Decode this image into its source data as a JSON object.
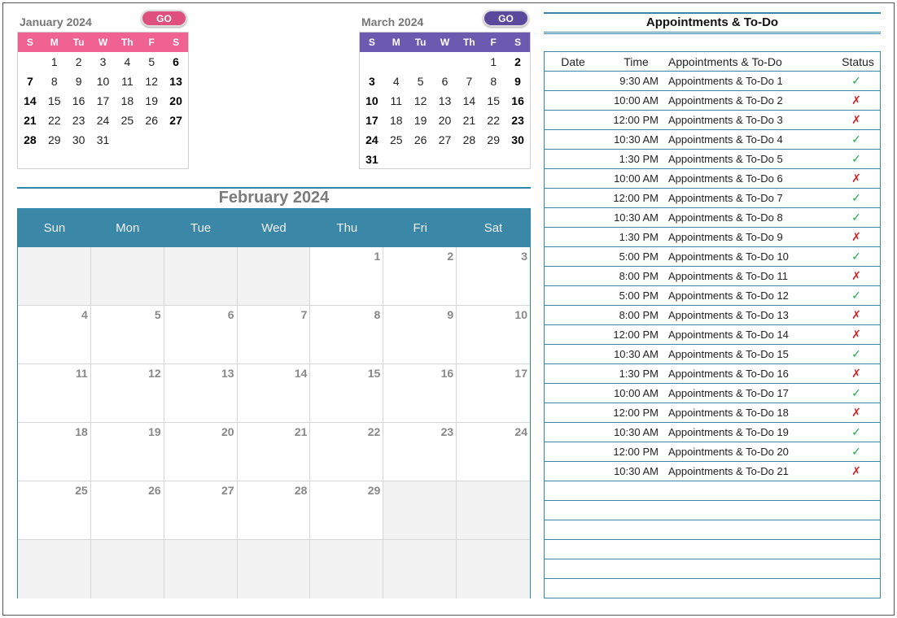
{
  "colors": {
    "accent": "#3a87a8",
    "january_header": "#f06292",
    "march_header": "#6a5bb0",
    "go_january": "#e0507f",
    "go_march": "#5a4a9e",
    "done": "#1fa84a",
    "not_done": "#d0232a"
  },
  "jan": {
    "title": "January 2024",
    "go": "GO",
    "dow": [
      "S",
      "M",
      "Tu",
      "W",
      "Th",
      "F",
      "S"
    ],
    "days": [
      "",
      "1",
      "2",
      "3",
      "4",
      "5",
      "6",
      "7",
      "8",
      "9",
      "10",
      "11",
      "12",
      "13",
      "14",
      "15",
      "16",
      "17",
      "18",
      "19",
      "20",
      "21",
      "22",
      "23",
      "24",
      "25",
      "26",
      "27",
      "28",
      "29",
      "30",
      "31"
    ]
  },
  "mar": {
    "title": "March 2024",
    "go": "GO",
    "dow": [
      "S",
      "M",
      "Tu",
      "W",
      "Th",
      "F",
      "S"
    ],
    "days": [
      "",
      "",
      "",
      "",
      "",
      "1",
      "2",
      "3",
      "4",
      "5",
      "6",
      "7",
      "8",
      "9",
      "10",
      "11",
      "12",
      "13",
      "14",
      "15",
      "16",
      "17",
      "18",
      "19",
      "20",
      "21",
      "22",
      "23",
      "24",
      "25",
      "26",
      "27",
      "28",
      "29",
      "30",
      "31"
    ]
  },
  "feb": {
    "title": "February 2024",
    "dow": [
      "Sun",
      "Mon",
      "Tue",
      "Wed",
      "Thu",
      "Fri",
      "Sat"
    ],
    "days": [
      "",
      "",
      "",
      "",
      "1",
      "2",
      "3",
      "4",
      "5",
      "6",
      "7",
      "8",
      "9",
      "10",
      "11",
      "12",
      "13",
      "14",
      "15",
      "16",
      "17",
      "18",
      "19",
      "20",
      "21",
      "22",
      "23",
      "24",
      "25",
      "26",
      "27",
      "28",
      "29",
      "",
      "",
      "",
      "",
      "",
      "",
      "",
      "",
      ""
    ]
  },
  "appointments": {
    "title": "Appointments & To-Do",
    "headers": {
      "date": "Date",
      "time": "Time",
      "text": "Appointments & To-Do",
      "status": "Status"
    },
    "rows": [
      {
        "time": "9:30 AM",
        "text": "Appointments & To-Do 1",
        "status": "done"
      },
      {
        "time": "10:00 AM",
        "text": "Appointments & To-Do 2",
        "status": "not_done"
      },
      {
        "time": "12:00 PM",
        "text": "Appointments & To-Do 3",
        "status": "not_done"
      },
      {
        "time": "10:30 AM",
        "text": "Appointments & To-Do 4",
        "status": "done"
      },
      {
        "time": "1:30 PM",
        "text": "Appointments & To-Do 5",
        "status": "done"
      },
      {
        "time": "10:00 AM",
        "text": "Appointments & To-Do 6",
        "status": "not_done"
      },
      {
        "time": "12:00 PM",
        "text": "Appointments & To-Do 7",
        "status": "done"
      },
      {
        "time": "10:30 AM",
        "text": "Appointments & To-Do 8",
        "status": "done"
      },
      {
        "time": "1:30 PM",
        "text": "Appointments & To-Do 9",
        "status": "not_done"
      },
      {
        "time": "5:00 PM",
        "text": "Appointments & To-Do 10",
        "status": "done"
      },
      {
        "time": "8:00 PM",
        "text": "Appointments & To-Do 11",
        "status": "not_done"
      },
      {
        "time": "5:00 PM",
        "text": "Appointments & To-Do 12",
        "status": "done"
      },
      {
        "time": "8:00 PM",
        "text": "Appointments & To-Do 13",
        "status": "not_done"
      },
      {
        "time": "12:00 PM",
        "text": "Appointments & To-Do 14",
        "status": "not_done"
      },
      {
        "time": "10:30 AM",
        "text": "Appointments & To-Do 15",
        "status": "done"
      },
      {
        "time": "1:30 PM",
        "text": "Appointments & To-Do 16",
        "status": "not_done"
      },
      {
        "time": "10:00 AM",
        "text": "Appointments & To-Do 17",
        "status": "done"
      },
      {
        "time": "12:00 PM",
        "text": "Appointments & To-Do 18",
        "status": "not_done"
      },
      {
        "time": "10:30 AM",
        "text": "Appointments & To-Do 19",
        "status": "done"
      },
      {
        "time": "12:00 PM",
        "text": "Appointments & To-Do 20",
        "status": "done"
      },
      {
        "time": "10:30 AM",
        "text": "Appointments & To-Do 21",
        "status": "not_done"
      }
    ],
    "empty_rows": 6
  },
  "icons": {
    "done": "check-icon",
    "not_done": "cross-icon"
  }
}
